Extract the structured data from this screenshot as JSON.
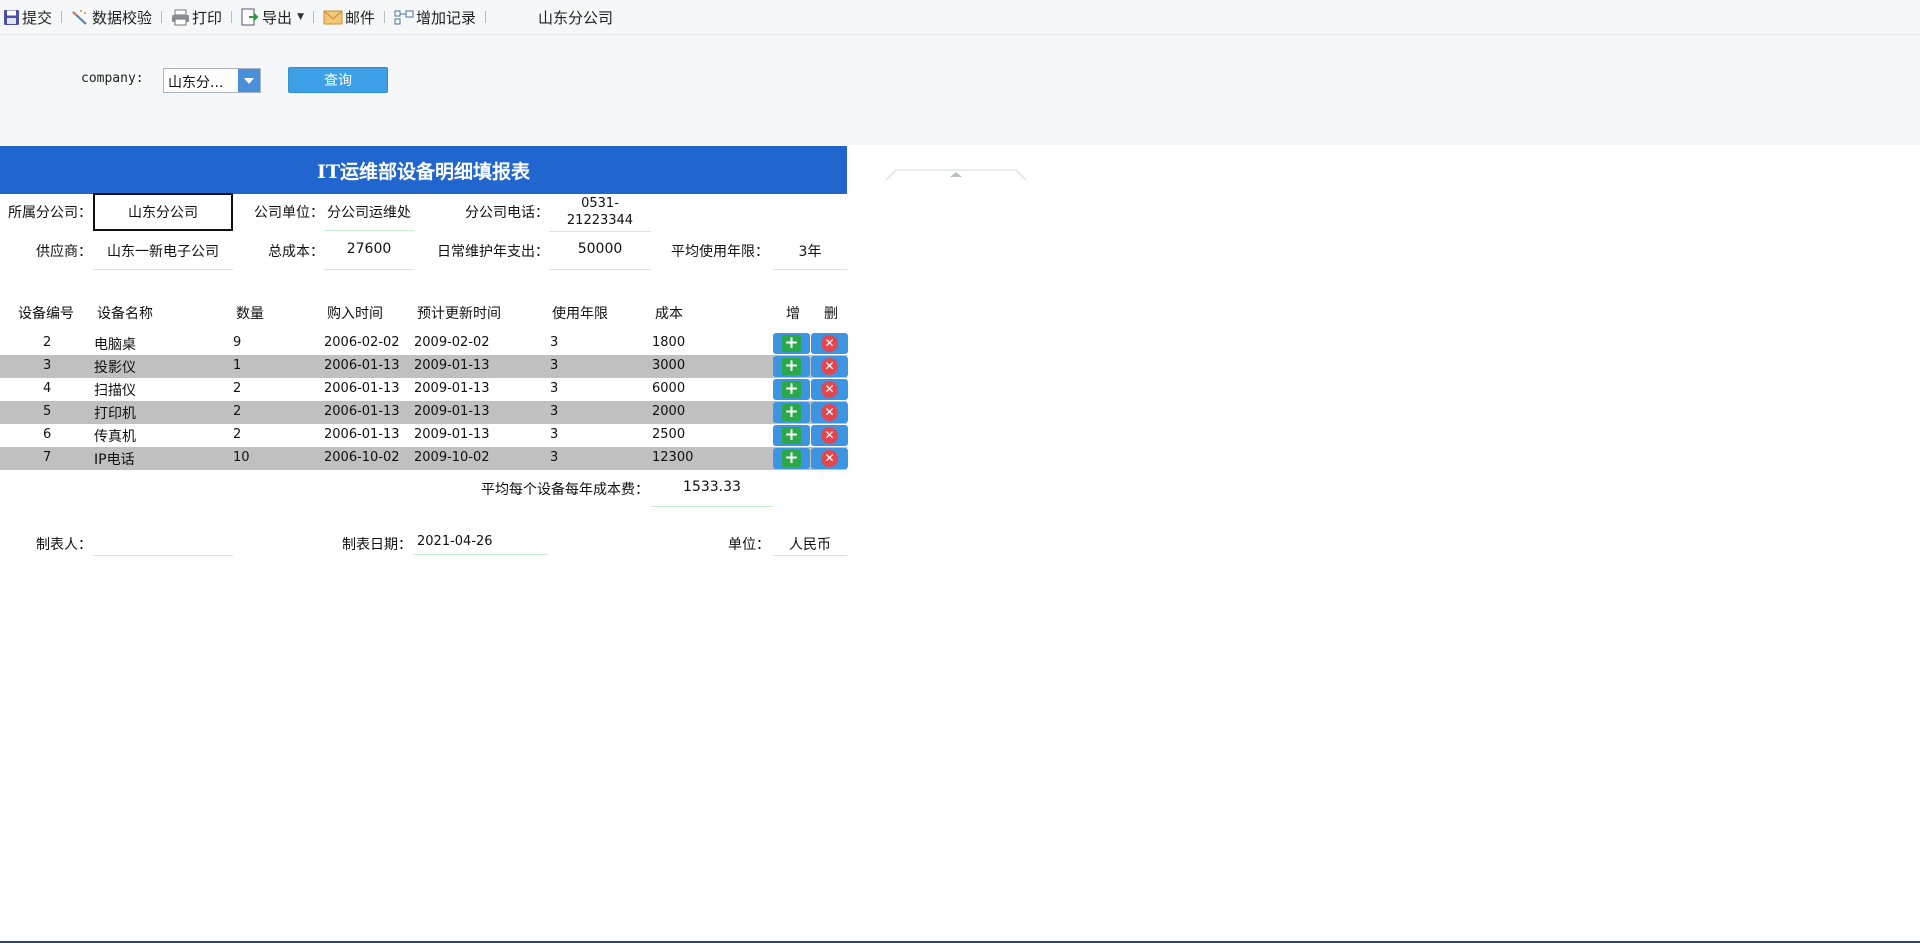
{
  "toolbar": {
    "submit": "提交",
    "validate": "数据校验",
    "print": "打印",
    "export": "导出",
    "mail": "邮件",
    "add_record": "增加记录",
    "context_title": "山东分公司"
  },
  "params": {
    "company_label": "company:",
    "company_value": "山东分...",
    "query_button": "查询"
  },
  "report": {
    "title": "IT运维部设备明细填报表",
    "fields": {
      "branch_label": "所属分公司：",
      "branch_value": "山东分公司",
      "unit_label": "公司单位：",
      "unit_value": "分公司运维处",
      "phone_label": "分公司电话：",
      "phone_value": "0531-21223344",
      "supplier_label": "供应商：",
      "supplier_value": "山东一新电子公司",
      "total_cost_label": "总成本：",
      "total_cost_value": "27600",
      "maintenance_label": "日常维护年支出：",
      "maintenance_value": "50000",
      "avg_years_label": "平均使用年限：",
      "avg_years_value": "3年"
    },
    "columns": {
      "id": "设备编号",
      "name": "设备名称",
      "qty": "数量",
      "purchase": "购入时间",
      "renew": "预计更新时间",
      "years": "使用年限",
      "cost": "成本",
      "add": "增",
      "delete": "删"
    },
    "rows": [
      {
        "id": "2",
        "name": "电脑桌",
        "qty": "9",
        "purchase": "2006-02-02",
        "renew": "2009-02-02",
        "years": "3",
        "cost": "1800"
      },
      {
        "id": "3",
        "name": "投影仪",
        "qty": "1",
        "purchase": "2006-01-13",
        "renew": "2009-01-13",
        "years": "3",
        "cost": "3000"
      },
      {
        "id": "4",
        "name": "扫描仪",
        "qty": "2",
        "purchase": "2006-01-13",
        "renew": "2009-01-13",
        "years": "3",
        "cost": "6000"
      },
      {
        "id": "5",
        "name": "打印机",
        "qty": "2",
        "purchase": "2006-01-13",
        "renew": "2009-01-13",
        "years": "3",
        "cost": "2000"
      },
      {
        "id": "6",
        "name": "传真机",
        "qty": "2",
        "purchase": "2006-01-13",
        "renew": "2009-01-13",
        "years": "3",
        "cost": "2500"
      },
      {
        "id": "7",
        "name": "IP电话",
        "qty": "10",
        "purchase": "2006-10-02",
        "renew": "2009-10-02",
        "years": "3",
        "cost": "12300"
      }
    ],
    "avg_cost_label": "平均每个设备每年成本费：",
    "avg_cost_value": "1533.33",
    "footer": {
      "maker_label": "制表人：",
      "maker_value": "",
      "date_label": "制表日期：",
      "date_value": "2021-04-26",
      "currency_label": "单位：",
      "currency_value": "人民币"
    }
  },
  "colors": {
    "title_bar": "#2166cf",
    "query_button": "#3d9fe6",
    "alt_row": "#c0c0c0",
    "add_icon": "#2aa84a",
    "delete_icon": "#e2474f",
    "field_underline": "#c9f0cc"
  },
  "icons": {
    "submit": "save-icon",
    "validate": "wand-icon",
    "print": "printer-icon",
    "export": "export-icon",
    "mail": "mail-icon",
    "add_record": "add-record-icon",
    "row_add": "plus-icon",
    "row_delete": "close-icon"
  }
}
